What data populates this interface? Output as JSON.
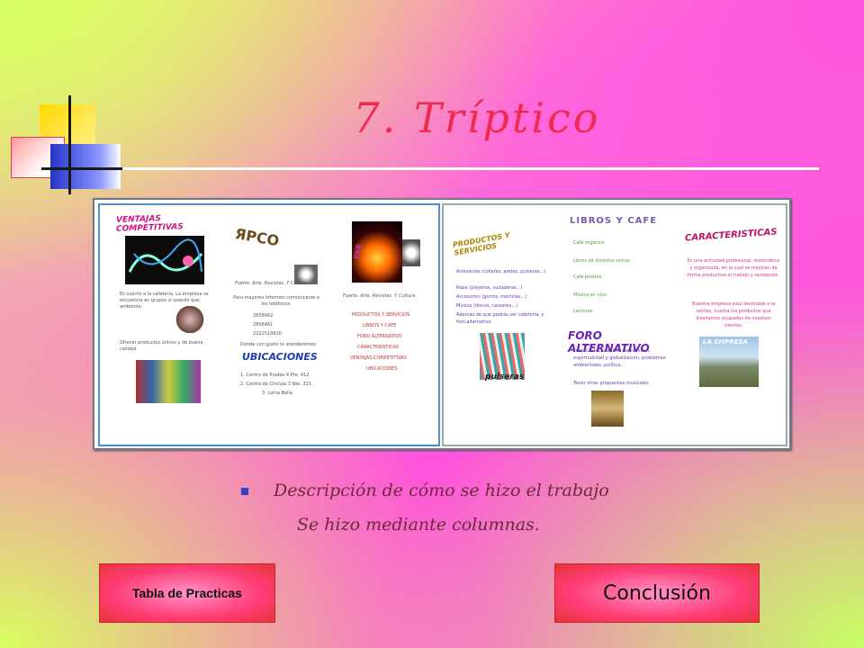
{
  "slide": {
    "title": "7.  Tríptico",
    "bullet": "Descripción de cómo se hizo el trabajo",
    "bullet_continuation": "Se hizo mediante columnas."
  },
  "buttons": {
    "left_label": "Tabla de Practicas",
    "right_label": "Conclusión"
  },
  "triptych": {
    "panel1": {
      "heading": "VENTAJAS COMPETITIVAS",
      "items": [
        "Es cuanto a la cafetería. La empresa se encuentra en grupos si usando que ambiente.",
        "Ofrecer productos únicos y de buena calidad."
      ]
    },
    "panel2": {
      "subtitle": "Fuerte. Arte. Revistas. Y Cultura",
      "intro": "Para mayores informes comunicarse a los teléfonos:",
      "phones": [
        "2858662",
        "2858461",
        "2221519910"
      ],
      "note": "Donde con gusto te atenderemos.",
      "heading": "UBICACIONES",
      "locations": [
        "1. Centro de Puebla 4 Pte. 412",
        "2. Centro de Cholula 3 Nte. 321",
        "3. Loma Bella"
      ]
    },
    "panel3": {
      "subtitle": "Fuerte. Arte. Revistas. Y Cultura",
      "menu": [
        "PRODUCTOS Y SERVICIOS",
        "LIBROS Y CAFE",
        "FORO ALTERNATIVO",
        "CARACTERISTICAS",
        "VENTAJAS COMPETITIVAS",
        "UBICACIONES"
      ]
    },
    "panel4": {
      "heading": "PRODUCTOS Y SERVICIOS",
      "items": [
        "Artesanías (collares, aretes, pulseras...)",
        "Ropa (playeras, sudaderas...)",
        "Accesorios (gorros, mochilas...)",
        "Música (discos, cassetes...)",
        "Además de que podrás ver cafetería, y foro alternativo."
      ],
      "image_caption": "pulseras"
    },
    "panel5": {
      "heading": "LIBROS Y CAFE",
      "items": [
        "Café orgánico",
        "Libros de distintos temas",
        "Café postres",
        "Música en vivo",
        "Lecturas"
      ],
      "heading2": "FORO ALTERNATIVO",
      "items2": [
        "Foro con lectura, arte, sexualidad, espiritualidad y globalización, problemas ambientales, política...",
        "Tener otras propuestas musicales"
      ]
    },
    "panel6": {
      "heading": "CARACTERISTICAS",
      "text1": "Es una actividad profesional, sistemática y organizada, en la cual se mezclan de forma productiva el trabajo y recreación.",
      "text2": "Nuestra empresa está destinada a la ventas, cuenta los productos que diseñamos ocupados de nuestros clientes.",
      "image_caption": "LA EMPRESA"
    }
  },
  "colors": {
    "title": "#ee2c52",
    "body_text": "#6b2a3a",
    "bullet_square": "#3b3bd0",
    "button_fill": "#ff3d77"
  }
}
